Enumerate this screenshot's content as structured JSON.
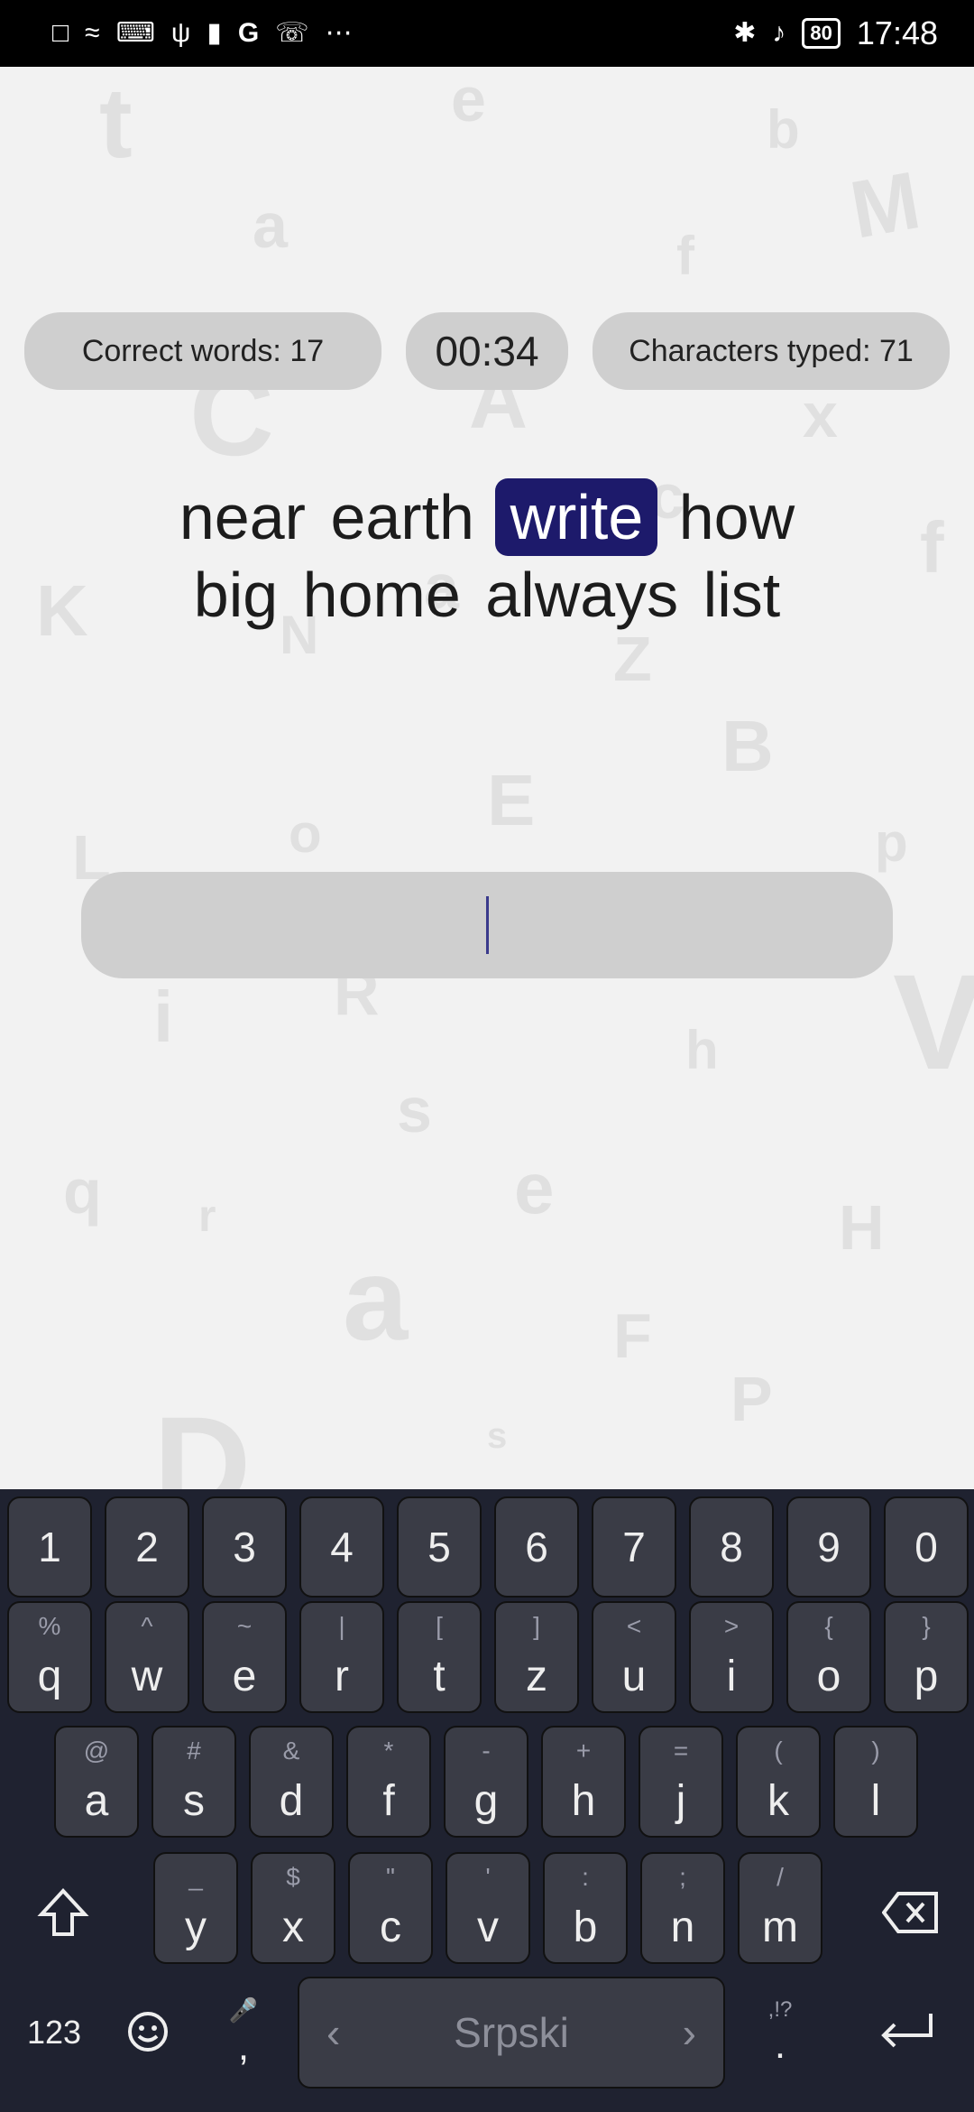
{
  "status_bar": {
    "time": "17:48",
    "battery": "80",
    "left_icons": [
      "alert-icon",
      "wifi-icon",
      "keyboard-icon",
      "usb-icon",
      "battery-saver-icon",
      "google-icon",
      "whatsapp-icon",
      "more-icon"
    ],
    "right_icons": [
      "bluetooth-icon",
      "mute-icon"
    ]
  },
  "stats": {
    "correct_words": "Correct words: 17",
    "timer": "00:34",
    "characters_typed": "Characters typed: 71"
  },
  "words": {
    "line1": [
      {
        "text": "near",
        "current": false
      },
      {
        "text": "earth",
        "current": false
      },
      {
        "text": "write",
        "current": true
      },
      {
        "text": "how",
        "current": false
      }
    ],
    "line2": [
      {
        "text": "big",
        "current": false
      },
      {
        "text": "home",
        "current": false
      },
      {
        "text": "always",
        "current": false
      },
      {
        "text": "list",
        "current": false
      }
    ]
  },
  "input": {
    "value": ""
  },
  "keyboard": {
    "row_numbers": [
      "1",
      "2",
      "3",
      "4",
      "5",
      "6",
      "7",
      "8",
      "9",
      "0"
    ],
    "row1": [
      {
        "key": "q",
        "hint": "%"
      },
      {
        "key": "w",
        "hint": "^"
      },
      {
        "key": "e",
        "hint": "~"
      },
      {
        "key": "r",
        "hint": "|"
      },
      {
        "key": "t",
        "hint": "["
      },
      {
        "key": "z",
        "hint": "]"
      },
      {
        "key": "u",
        "hint": "<"
      },
      {
        "key": "i",
        "hint": ">"
      },
      {
        "key": "o",
        "hint": "{"
      },
      {
        "key": "p",
        "hint": "}"
      }
    ],
    "row2": [
      {
        "key": "a",
        "hint": "@"
      },
      {
        "key": "s",
        "hint": "#"
      },
      {
        "key": "d",
        "hint": "&"
      },
      {
        "key": "f",
        "hint": "*"
      },
      {
        "key": "g",
        "hint": "-"
      },
      {
        "key": "h",
        "hint": "+"
      },
      {
        "key": "j",
        "hint": "="
      },
      {
        "key": "k",
        "hint": "("
      },
      {
        "key": "l",
        "hint": ")"
      }
    ],
    "row3": [
      {
        "key": "y",
        "hint": "_"
      },
      {
        "key": "x",
        "hint": "$"
      },
      {
        "key": "c",
        "hint": "\""
      },
      {
        "key": "v",
        "hint": "'"
      },
      {
        "key": "b",
        "hint": ":"
      },
      {
        "key": "n",
        "hint": ";"
      },
      {
        "key": "m",
        "hint": "/"
      }
    ],
    "symbols_label": "123",
    "comma": ",",
    "period": ".",
    "punct_hint": ",!?",
    "space_label": "Srpski"
  }
}
